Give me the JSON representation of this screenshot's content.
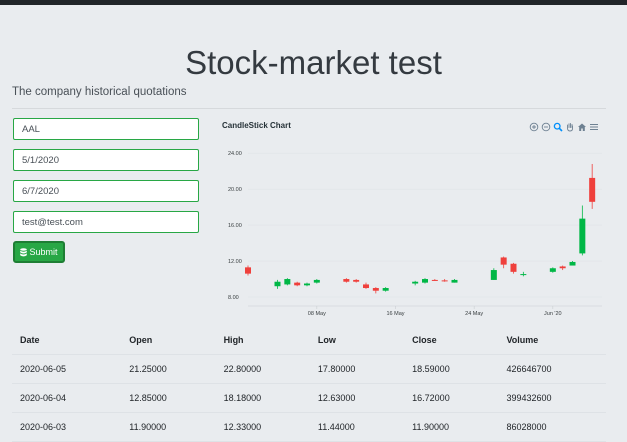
{
  "page": {
    "title": "Stock-market test",
    "subtitle": "The company historical quotations"
  },
  "form": {
    "symbol": "AAL",
    "start_date": "5/1/2020",
    "end_date": "6/7/2020",
    "email": "test@test.com",
    "submit_label": "Submit"
  },
  "chart": {
    "title": "CandleStick Chart",
    "toolbar": [
      "zoom-in-icon",
      "zoom-out-icon",
      "search-zoom-icon",
      "pan-hand-icon",
      "home-icon",
      "menu-icon"
    ]
  },
  "chart_data": {
    "type": "candlestick",
    "title": "CandleStick Chart",
    "ylim": [
      7,
      24.8
    ],
    "yticks": [
      "24.00",
      "20.00",
      "16.00",
      "12.00",
      "8.00"
    ],
    "yticks_values": [
      24,
      20,
      16,
      12,
      8
    ],
    "xticks": [
      "08 May",
      "16 May",
      "24 May",
      "Jun '20"
    ],
    "xticks_values": [
      8,
      16,
      24,
      32
    ],
    "x_domain": [
      1,
      37
    ],
    "colors": {
      "up": "#00b746",
      "down": "#ef403c"
    },
    "candles": [
      {
        "day": 1,
        "open": 11.3,
        "high": 11.5,
        "low": 10.4,
        "close": 10.6
      },
      {
        "day": 4,
        "open": 9.2,
        "high": 9.9,
        "low": 8.9,
        "close": 9.7
      },
      {
        "day": 5,
        "open": 9.4,
        "high": 10.1,
        "low": 9.3,
        "close": 10.0
      },
      {
        "day": 6,
        "open": 9.6,
        "high": 9.7,
        "low": 9.2,
        "close": 9.3
      },
      {
        "day": 7,
        "open": 9.3,
        "high": 9.6,
        "low": 9.2,
        "close": 9.5
      },
      {
        "day": 8,
        "open": 9.6,
        "high": 10.0,
        "low": 9.5,
        "close": 9.9
      },
      {
        "day": 11,
        "open": 10.0,
        "high": 10.1,
        "low": 9.6,
        "close": 9.7
      },
      {
        "day": 12,
        "open": 9.9,
        "high": 10.0,
        "low": 9.6,
        "close": 9.7
      },
      {
        "day": 13,
        "open": 9.4,
        "high": 9.6,
        "low": 8.9,
        "close": 9.0
      },
      {
        "day": 14,
        "open": 9.0,
        "high": 9.1,
        "low": 8.4,
        "close": 8.7
      },
      {
        "day": 15,
        "open": 8.7,
        "high": 9.1,
        "low": 8.6,
        "close": 9.0
      },
      {
        "day": 18,
        "open": 9.5,
        "high": 9.8,
        "low": 9.3,
        "close": 9.7
      },
      {
        "day": 19,
        "open": 9.6,
        "high": 10.1,
        "low": 9.5,
        "close": 10.0
      },
      {
        "day": 20,
        "open": 9.9,
        "high": 10.0,
        "low": 9.8,
        "close": 9.85
      },
      {
        "day": 21,
        "open": 9.85,
        "high": 10.0,
        "low": 9.7,
        "close": 9.8
      },
      {
        "day": 22,
        "open": 9.6,
        "high": 10.0,
        "low": 9.6,
        "close": 9.9
      },
      {
        "day": 26,
        "open": 9.9,
        "high": 11.2,
        "low": 9.9,
        "close": 11.0
      },
      {
        "day": 27,
        "open": 12.4,
        "high": 12.5,
        "low": 11.2,
        "close": 11.6
      },
      {
        "day": 28,
        "open": 11.7,
        "high": 11.8,
        "low": 10.6,
        "close": 10.8
      },
      {
        "day": 29,
        "open": 10.5,
        "high": 10.8,
        "low": 10.3,
        "close": 10.55
      },
      {
        "day": 32,
        "open": 10.8,
        "high": 11.3,
        "low": 10.7,
        "close": 11.2
      },
      {
        "day": 33,
        "open": 11.4,
        "high": 11.5,
        "low": 11.0,
        "close": 11.2
      },
      {
        "day": 34,
        "open": 11.5,
        "high": 12.0,
        "low": 11.5,
        "close": 11.9
      },
      {
        "day": 35,
        "open": 12.85,
        "high": 18.18,
        "low": 12.63,
        "close": 16.72
      },
      {
        "day": 36,
        "open": 21.25,
        "high": 22.8,
        "low": 17.8,
        "close": 18.59
      }
    ]
  },
  "table": {
    "headers": [
      "Date",
      "Open",
      "High",
      "Low",
      "Close",
      "Volume"
    ],
    "rows": [
      [
        "2020-06-05",
        "21.25000",
        "22.80000",
        "17.80000",
        "18.59000",
        "426646700"
      ],
      [
        "2020-06-04",
        "12.85000",
        "18.18000",
        "12.63000",
        "16.72000",
        "399432600"
      ],
      [
        "2020-06-03",
        "11.90000",
        "12.33000",
        "11.44000",
        "11.90000",
        "86028000"
      ]
    ]
  }
}
